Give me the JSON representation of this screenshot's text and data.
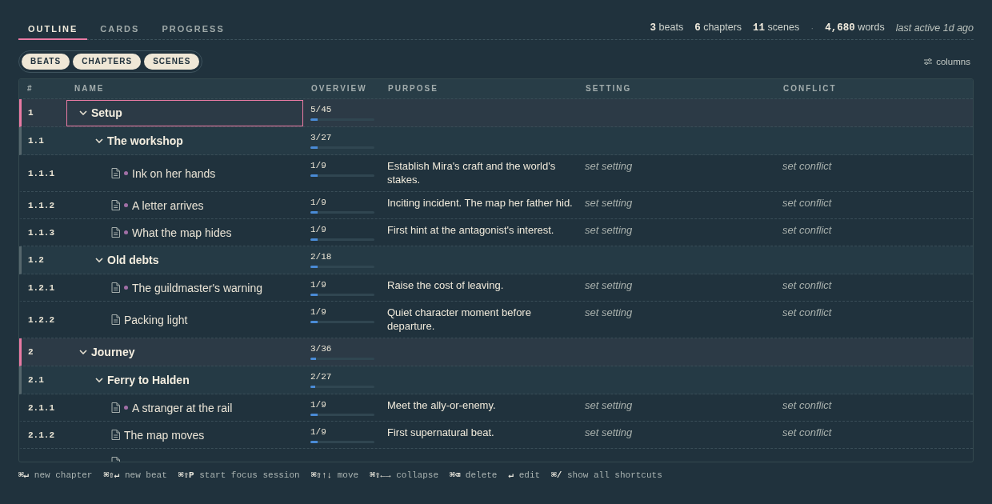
{
  "tabs": [
    {
      "label": "OUTLINE",
      "selected": true
    },
    {
      "label": "CARDS",
      "selected": false
    },
    {
      "label": "PROGRESS",
      "selected": false
    }
  ],
  "stats": {
    "counts": [
      "**3** beats",
      "**6** chapters",
      "**11** scenes"
    ],
    "separator": "·",
    "words": "**4,680** words",
    "last_active": "last active 1d ago"
  },
  "filters": [
    {
      "label": "BEATS",
      "on": true
    },
    {
      "label": "CHAPTERS",
      "on": true
    },
    {
      "label": "SCENES",
      "on": true
    }
  ],
  "columns_button": {
    "label": "columns"
  },
  "table": {
    "columns": [
      "#",
      "NAME",
      "OVERVIEW",
      "PURPOSE",
      "SETTING",
      "CONFLICT"
    ],
    "rows": [
      {
        "kind": "beat",
        "number": "1",
        "name": "Setup",
        "expanded": true,
        "focused": true,
        "overview": "5/45",
        "level": 0.111,
        "children": [
          {
            "kind": "chapter",
            "number": "1.1",
            "name": "The workshop",
            "expanded": true,
            "focused": false,
            "overview": "3/27",
            "level": 0.111,
            "children": [
              {
                "kind": "scene",
                "number": "1.1.1",
                "name": "Ink on her hands",
                "status_dot": true,
                "focused": false,
                "overview": "1/9",
                "level": 0.111,
                "purpose": {
                  "value": "Establish Mira's craft and the world's stakes."
                },
                "setting": {
                  "placeholder": "set setting"
                },
                "conflict": {
                  "placeholder": "set conflict"
                }
              },
              {
                "kind": "scene",
                "number": "1.1.2",
                "name": "A letter arrives",
                "status_dot": true,
                "focused": false,
                "overview": "1/9",
                "level": 0.111,
                "purpose": {
                  "value": "Inciting incident. The map her father hid."
                },
                "setting": {
                  "placeholder": "set setting"
                },
                "conflict": {
                  "placeholder": "set conflict"
                }
              },
              {
                "kind": "scene",
                "number": "1.1.3",
                "name": "What the map hides",
                "status_dot": true,
                "focused": false,
                "overview": "1/9",
                "level": 0.111,
                "purpose": {
                  "value": "First hint at the antagonist's interest."
                },
                "setting": {
                  "placeholder": "set setting"
                },
                "conflict": {
                  "placeholder": "set conflict"
                }
              }
            ]
          },
          {
            "kind": "chapter",
            "number": "1.2",
            "name": "Old debts",
            "expanded": true,
            "focused": false,
            "overview": "2/18",
            "level": 0.111,
            "children": [
              {
                "kind": "scene",
                "number": "1.2.1",
                "name": "The guildmaster's warning",
                "status_dot": true,
                "focused": false,
                "overview": "1/9",
                "level": 0.111,
                "purpose": {
                  "value": "Raise the cost of leaving."
                },
                "setting": {
                  "placeholder": "set setting"
                },
                "conflict": {
                  "placeholder": "set conflict"
                }
              },
              {
                "kind": "scene",
                "number": "1.2.2",
                "name": "Packing light",
                "status_dot": false,
                "focused": false,
                "overview": "1/9",
                "level": 0.111,
                "purpose": {
                  "value": "Quiet character moment before departure."
                },
                "setting": {
                  "placeholder": "set setting"
                },
                "conflict": {
                  "placeholder": "set conflict"
                }
              }
            ]
          }
        ]
      },
      {
        "kind": "beat",
        "number": "2",
        "name": "Journey",
        "expanded": true,
        "focused": false,
        "overview": "3/36",
        "level": 0.083,
        "children": [
          {
            "kind": "chapter",
            "number": "2.1",
            "name": "Ferry to Halden",
            "expanded": true,
            "focused": false,
            "overview": "2/27",
            "level": 0.074,
            "children": [
              {
                "kind": "scene",
                "number": "2.1.1",
                "name": "A stranger at the rail",
                "status_dot": true,
                "focused": false,
                "overview": "1/9",
                "level": 0.111,
                "purpose": {
                  "value": "Meet the ally-or-enemy."
                },
                "setting": {
                  "placeholder": "set setting"
                },
                "conflict": {
                  "placeholder": "set conflict"
                }
              },
              {
                "kind": "scene",
                "number": "2.1.2",
                "name": "The map moves",
                "status_dot": false,
                "focused": false,
                "overview": "1/9",
                "level": 0.111,
                "purpose": {
                  "value": "First supernatural beat."
                },
                "setting": {
                  "placeholder": "set setting"
                },
                "conflict": {
                  "placeholder": "set conflict"
                }
              },
              {
                "kind": "scene",
                "status_dot": false,
                "focused": false
              }
            ]
          }
        ]
      }
    ]
  },
  "shortcuts": [
    "**⌘↵** new chapter",
    "**⌘⇧↵** new beat",
    "**⌘⇧P** start focus session",
    "**⌘⇧↑↓** move",
    "**⌘⇧←→** collapse",
    "**⌘⌫** delete",
    "**↵** edit",
    "**⌘/** show all shortcuts"
  ]
}
